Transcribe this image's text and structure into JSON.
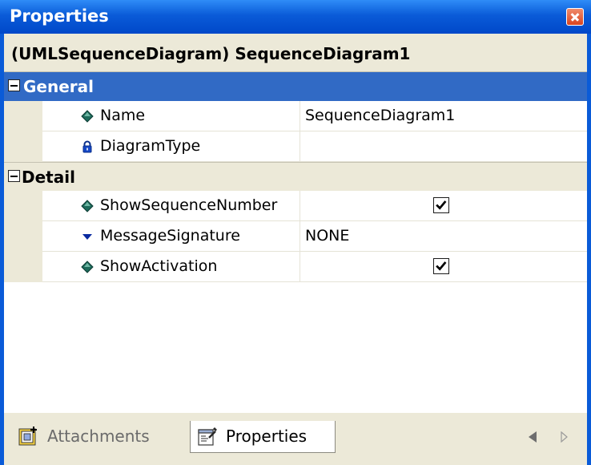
{
  "window": {
    "title": "Properties"
  },
  "object_selector": {
    "text": "(UMLSequenceDiagram) SequenceDiagram1"
  },
  "grid": {
    "categories": [
      {
        "label": "General",
        "properties": [
          {
            "name": "Name",
            "value": "SequenceDiagram1",
            "icon": "diamond-icon"
          },
          {
            "name": "DiagramType",
            "value": "",
            "icon": "lock-icon"
          }
        ]
      },
      {
        "label": "Detail",
        "properties": [
          {
            "name": "ShowSequenceNumber",
            "value": true,
            "icon": "diamond-icon"
          },
          {
            "name": "MessageSignature",
            "value": "NONE",
            "icon": "dropdown-triangle-icon"
          },
          {
            "name": "ShowActivation",
            "value": true,
            "icon": "diamond-icon"
          }
        ]
      }
    ]
  },
  "tabs": [
    {
      "label": "Attachments",
      "active": false,
      "icon": "attachments-icon"
    },
    {
      "label": "Properties",
      "active": true,
      "icon": "properties-icon"
    }
  ],
  "colors": {
    "title_bar": "#0a5bd8",
    "selection": "#316ac5",
    "panel": "#ece9d8",
    "close_button": "#d9441f"
  }
}
